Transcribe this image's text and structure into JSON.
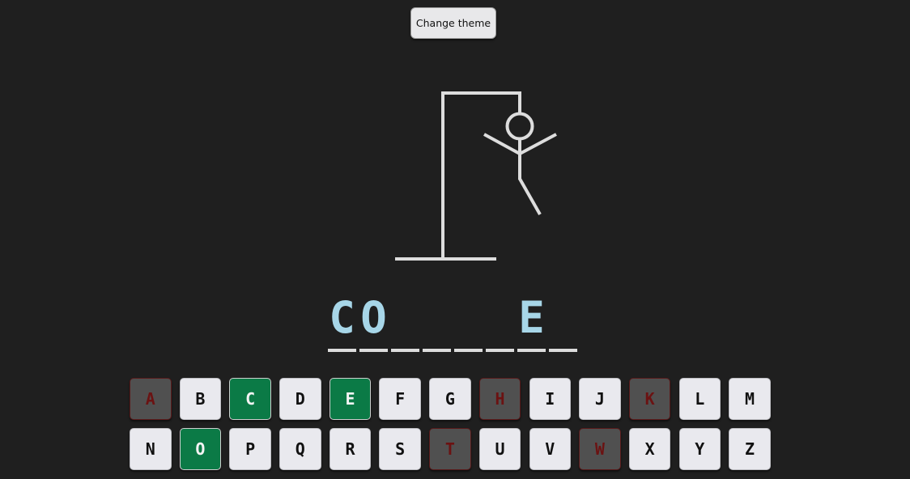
{
  "header": {
    "theme_button_label": "Change theme"
  },
  "drawing": {
    "icon": "hangman-figure-icon",
    "stroke_color": "#dddddd",
    "parts_shown": [
      "head",
      "body",
      "left-arm",
      "right-arm",
      "right-leg"
    ]
  },
  "word": {
    "slots": [
      "C",
      "O",
      "",
      "",
      "",
      "",
      "E",
      ""
    ]
  },
  "keyboard": {
    "rows": [
      [
        {
          "letter": "A",
          "state": "wrong"
        },
        {
          "letter": "B",
          "state": "unused"
        },
        {
          "letter": "C",
          "state": "correct"
        },
        {
          "letter": "D",
          "state": "unused"
        },
        {
          "letter": "E",
          "state": "correct"
        },
        {
          "letter": "F",
          "state": "unused"
        },
        {
          "letter": "G",
          "state": "unused"
        },
        {
          "letter": "H",
          "state": "wrong"
        },
        {
          "letter": "I",
          "state": "unused"
        },
        {
          "letter": "J",
          "state": "unused"
        },
        {
          "letter": "K",
          "state": "wrong"
        },
        {
          "letter": "L",
          "state": "unused"
        },
        {
          "letter": "M",
          "state": "unused"
        }
      ],
      [
        {
          "letter": "N",
          "state": "unused"
        },
        {
          "letter": "O",
          "state": "correct"
        },
        {
          "letter": "P",
          "state": "unused"
        },
        {
          "letter": "Q",
          "state": "unused"
        },
        {
          "letter": "R",
          "state": "unused"
        },
        {
          "letter": "S",
          "state": "unused"
        },
        {
          "letter": "T",
          "state": "wrong"
        },
        {
          "letter": "U",
          "state": "unused"
        },
        {
          "letter": "V",
          "state": "unused"
        },
        {
          "letter": "W",
          "state": "wrong"
        },
        {
          "letter": "X",
          "state": "unused"
        },
        {
          "letter": "Y",
          "state": "unused"
        },
        {
          "letter": "Z",
          "state": "unused"
        }
      ]
    ]
  },
  "colors": {
    "background": "#1f1f1f",
    "correct": "#0b7a46",
    "wrong": "#505050",
    "revealed_letter": "#a7d6e8"
  }
}
